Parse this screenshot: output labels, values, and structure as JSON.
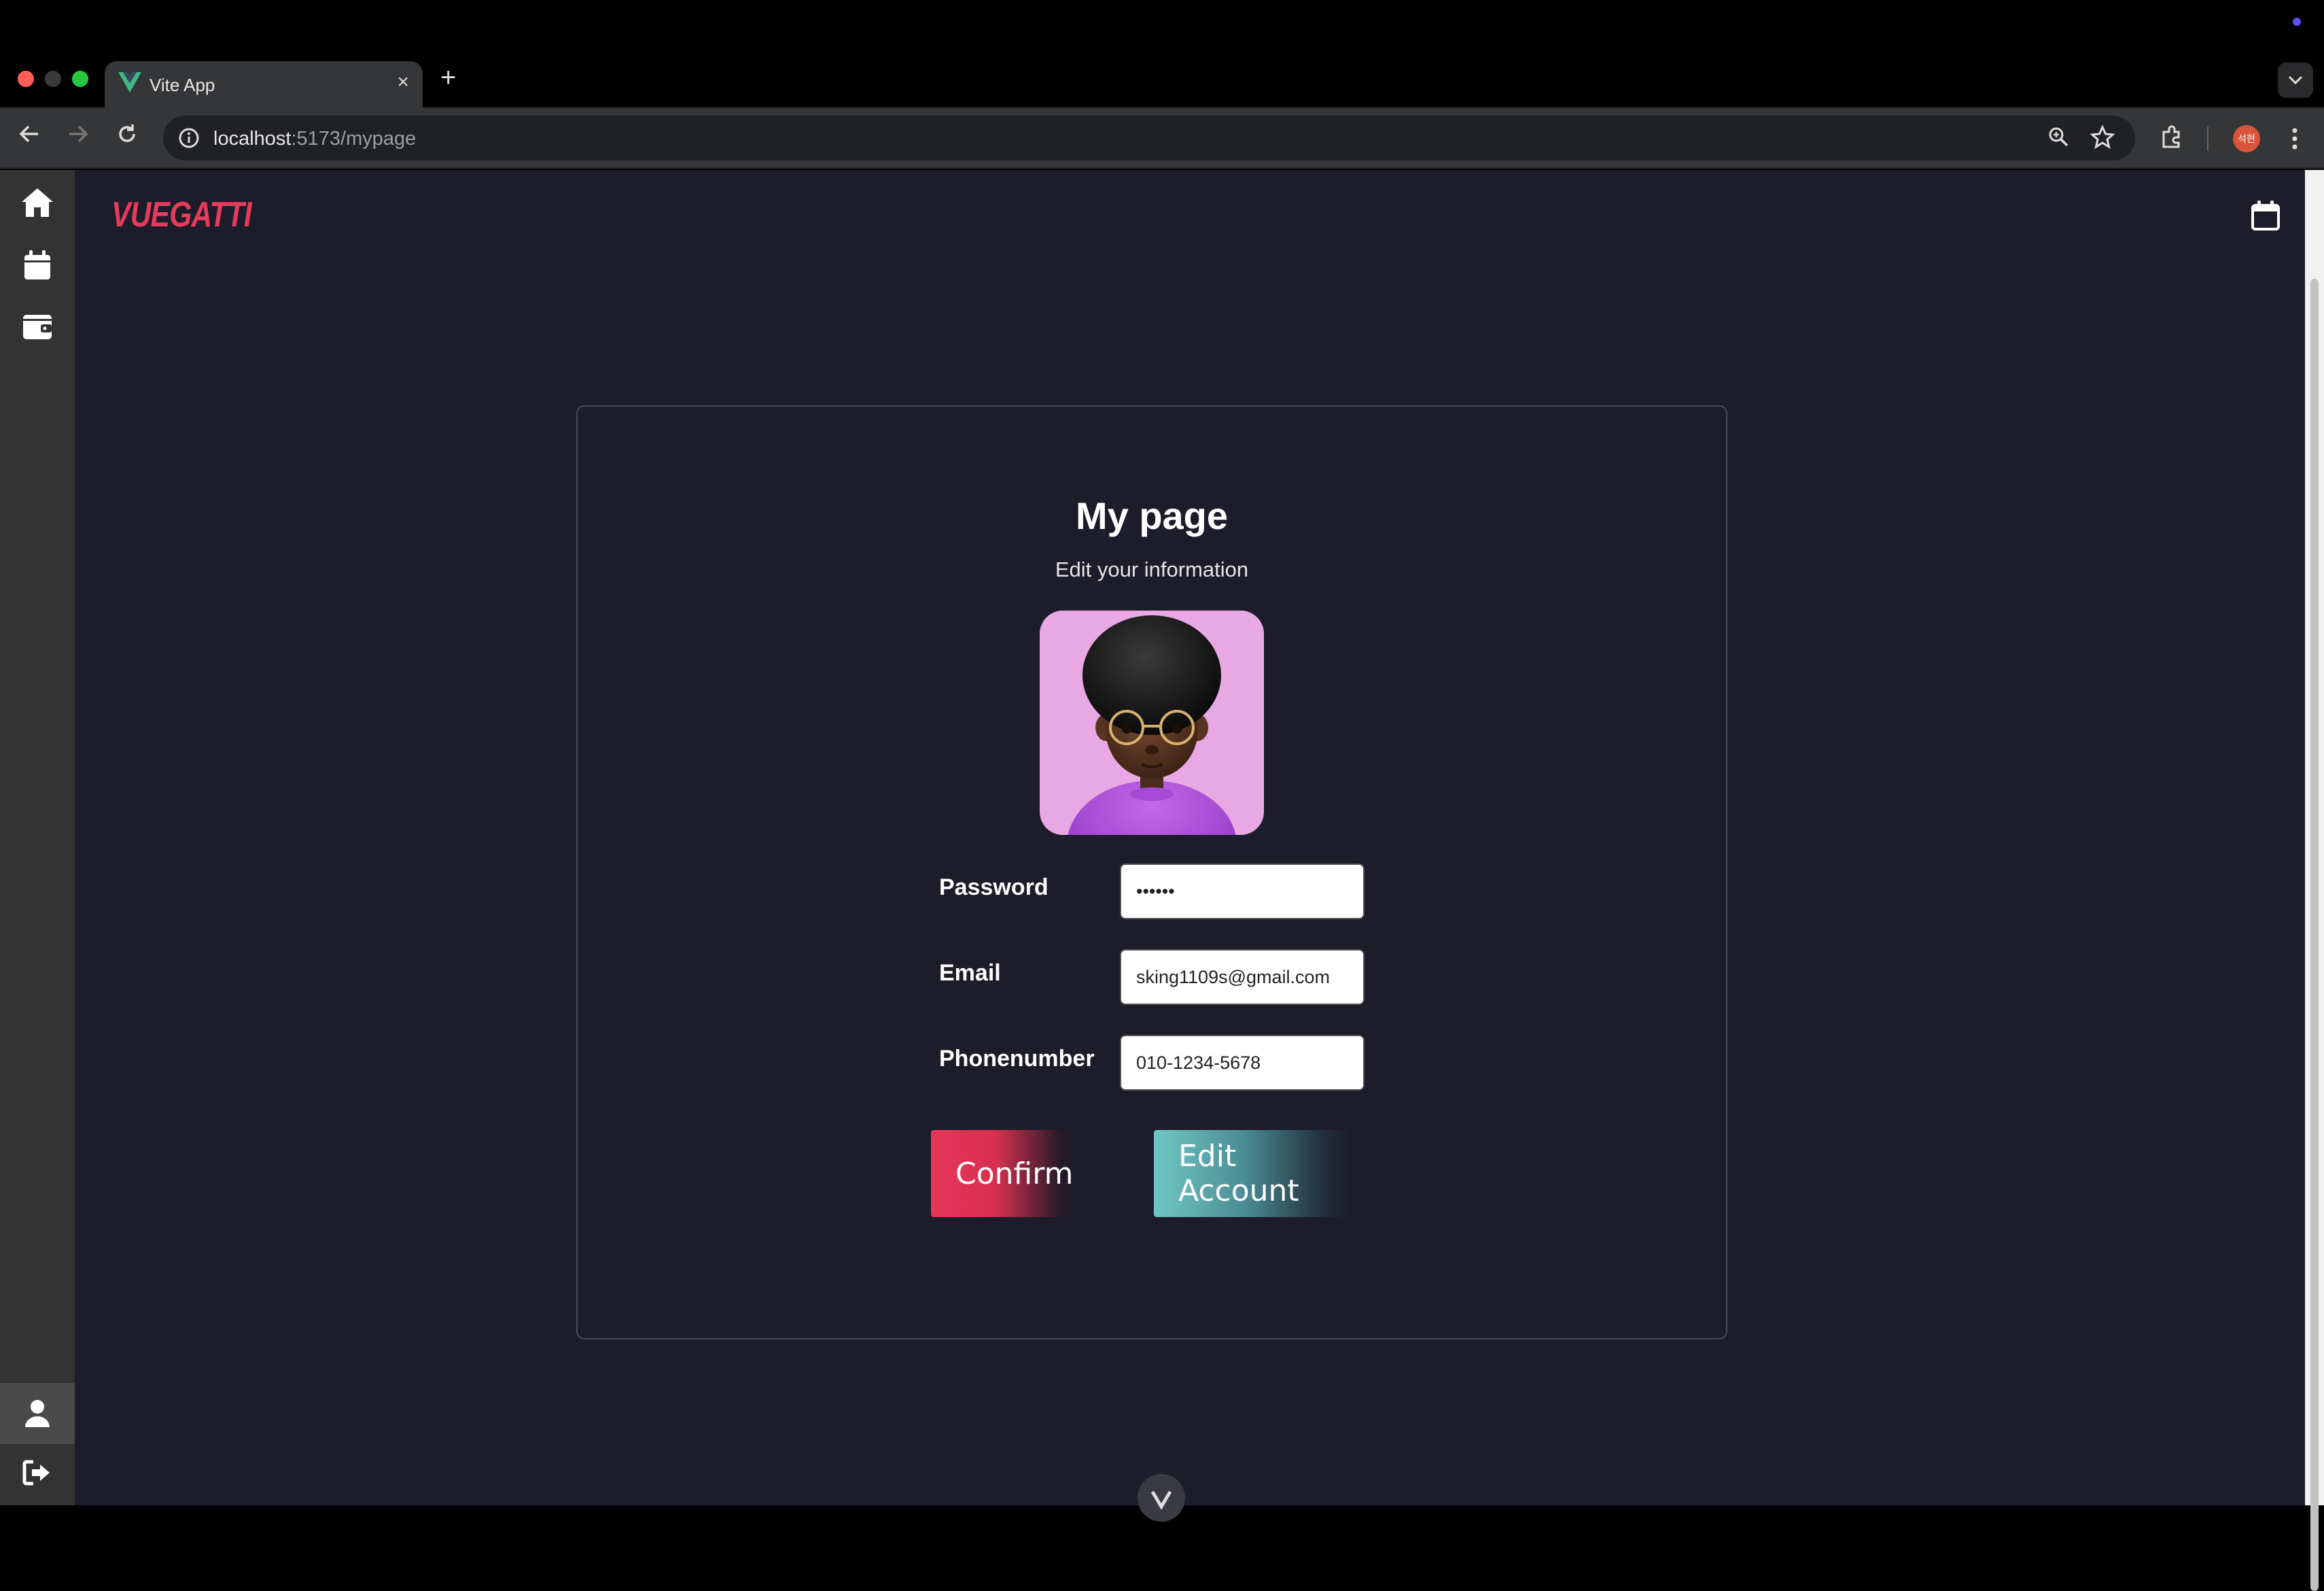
{
  "browser": {
    "tab_title": "Vite App",
    "tab_close": "×",
    "new_tab": "+",
    "url_host": "localhost",
    "url_path": ":5173/mypage",
    "profile_initials": "석현"
  },
  "app": {
    "logo": "VUEGATTI",
    "sidebar": [
      {
        "icon": "home-icon"
      },
      {
        "icon": "calendar-icon"
      },
      {
        "icon": "wallet-icon"
      }
    ],
    "sidebar_bottom": [
      {
        "icon": "user-icon",
        "active": true
      },
      {
        "icon": "logout-icon"
      }
    ]
  },
  "mypage": {
    "title": "My page",
    "subtitle": "Edit your information",
    "password_label": "Password",
    "password_value": "••••••",
    "email_label": "Email",
    "email_value": "sking1109s@gmail.com",
    "phone_label": "Phonenumber",
    "phone_value": "010-1234-5678",
    "confirm_label": "Confirm",
    "edit_label": "Edit Account"
  },
  "colors": {
    "background": "#1c1c2b",
    "accent_red": "#e8355a",
    "accent_teal": "#6fc8c4",
    "sidebar": "#333333"
  }
}
